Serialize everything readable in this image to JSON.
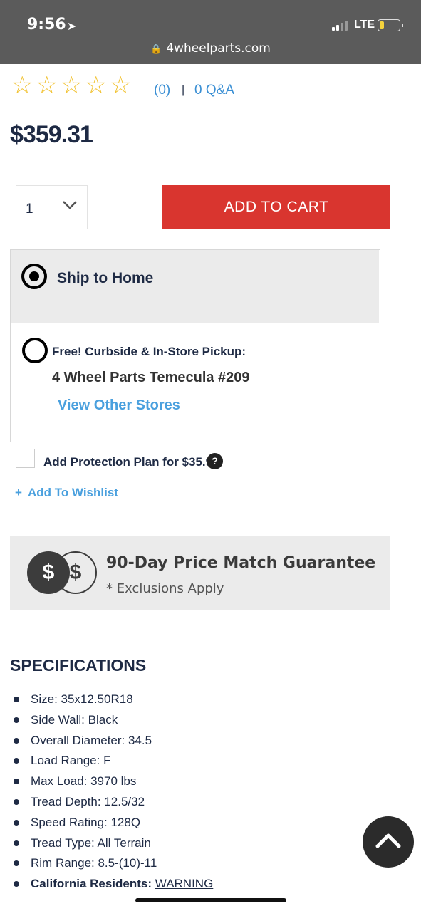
{
  "status_bar": {
    "time": "9:56",
    "network": "LTE",
    "url": "4wheelparts.com"
  },
  "rating": {
    "stars_filled": 0,
    "stars_total": 5,
    "reviews_link": "(0)",
    "separator": "|",
    "qa_link": "0 Q&A"
  },
  "price": "$359.31",
  "quantity": {
    "value": "1"
  },
  "add_to_cart": "ADD TO CART",
  "shipping": {
    "ship_home_label": "Ship to Home",
    "pickup_label": "Free! Curbside & In-Store Pickup:",
    "store_name": "4 Wheel Parts Temecula #209",
    "view_stores": "View Other Stores"
  },
  "protection": {
    "label": "Add Protection Plan for $35.93",
    "help": "?"
  },
  "wishlist": {
    "plus": "+",
    "label": "Add To Wishlist"
  },
  "guarantee": {
    "coin_symbol": "$",
    "title": "90-Day Price Match Guarantee",
    "subtitle": "* Exclusions Apply"
  },
  "specifications": {
    "title": "SPECIFICATIONS",
    "items": [
      "Size: 35x12.50R18",
      "Side Wall: Black",
      "Overall Diameter: 34.5",
      "Load Range: F",
      "Max Load: 3970 lbs",
      "Tread Depth: 12.5/32",
      "Speed Rating: 128Q",
      "Tread Type: All Terrain",
      "Rim Range: 8.5-(10)-11"
    ],
    "ca_label": "California Residents:",
    "ca_link": "WARNING"
  },
  "colors": {
    "add_to_cart_bg": "#d9352f",
    "link_blue": "#3a8fd4",
    "star_outline": "#f1c232",
    "text_navy": "#1e2a44"
  }
}
